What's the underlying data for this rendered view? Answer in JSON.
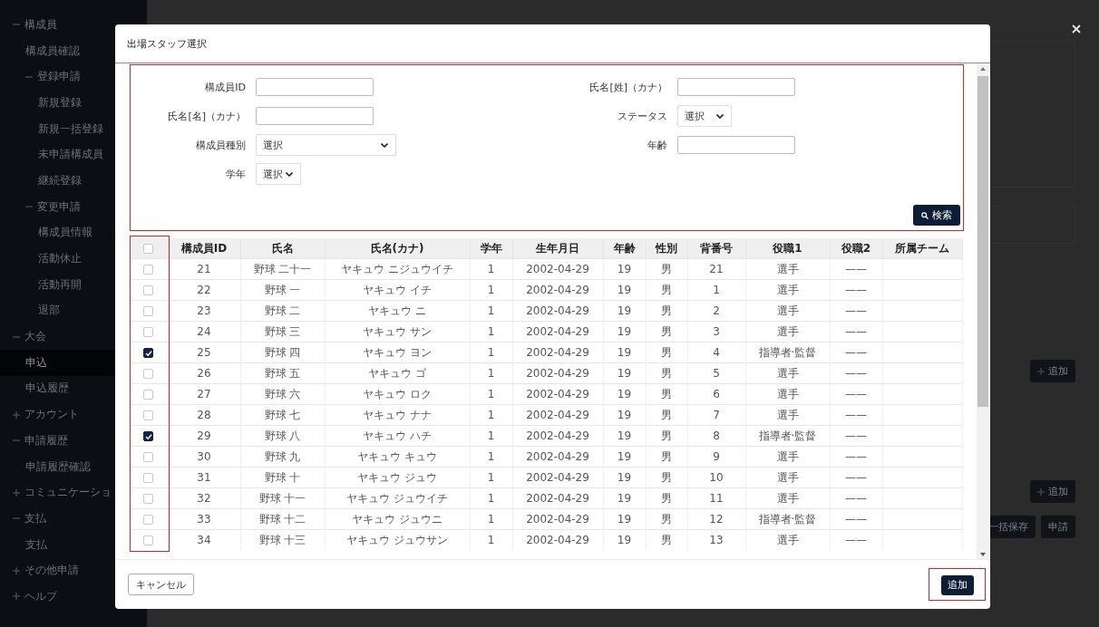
{
  "sidebar": {
    "items": [
      {
        "label": "構成員",
        "expanded": true,
        "selected": false,
        "children": [
          {
            "label": "構成員確認",
            "selected": false
          },
          {
            "label": "登録申請",
            "expanded": true,
            "selected": false,
            "children": [
              {
                "label": "新規登録",
                "selected": false
              },
              {
                "label": "新規一括登録",
                "selected": false
              },
              {
                "label": "未申請構成員",
                "selected": false
              },
              {
                "label": "継続登録",
                "selected": false
              }
            ]
          },
          {
            "label": "変更申請",
            "expanded": true,
            "selected": false,
            "children": [
              {
                "label": "構成員情報",
                "selected": false
              },
              {
                "label": "活動休止",
                "selected": false
              },
              {
                "label": "活動再開",
                "selected": false
              },
              {
                "label": "退部",
                "selected": false
              }
            ]
          }
        ]
      },
      {
        "label": "大会",
        "expanded": true,
        "selected": false,
        "children": [
          {
            "label": "申込",
            "selected": true
          },
          {
            "label": "申込履歴",
            "selected": false
          }
        ]
      },
      {
        "label": "アカウント",
        "expanded": false,
        "selected": false
      },
      {
        "label": "申請履歴",
        "expanded": true,
        "selected": false,
        "children": [
          {
            "label": "申請履歴確認",
            "selected": false
          }
        ]
      },
      {
        "label": "コミュニケーショ",
        "expanded": false,
        "selected": false
      },
      {
        "label": "支払",
        "expanded": true,
        "selected": false,
        "children": [
          {
            "label": "支払",
            "selected": false
          }
        ]
      },
      {
        "label": "その他申請",
        "expanded": false,
        "selected": false
      },
      {
        "label": "ヘルプ",
        "expanded": false,
        "selected": false
      }
    ]
  },
  "background": {
    "add_buttons": [
      "追加",
      "追加"
    ],
    "save_all_button": "一括保存",
    "submit_button": "申請"
  },
  "modal": {
    "title": "出場スタッフ選択",
    "search_form": {
      "fields": [
        {
          "label": "構成員ID",
          "kind": "text"
        },
        {
          "label": "氏名[姓]（カナ）",
          "kind": "text"
        },
        {
          "label": "氏名[名]（カナ）",
          "kind": "text"
        },
        {
          "label": "ステータス",
          "kind": "select",
          "value": "選択"
        },
        {
          "label": "構成員種別",
          "kind": "select",
          "value": "選択"
        },
        {
          "label": "年齢",
          "kind": "text"
        },
        {
          "label": "学年",
          "kind": "select",
          "value": "選択"
        }
      ],
      "search_button": "検索"
    },
    "table": {
      "all_checked": false,
      "columns": [
        "構成員ID",
        "氏名",
        "氏名(カナ)",
        "学年",
        "生年月日",
        "年齢",
        "性別",
        "背番号",
        "役職1",
        "役職2",
        "所属チーム"
      ],
      "rows": [
        {
          "checked": false,
          "cells": [
            "21",
            "野球 二十一",
            "ヤキュウ ニジュウイチ",
            "1",
            "2002-04-29",
            "19",
            "男",
            "21",
            "選手",
            "——"
          ]
        },
        {
          "checked": false,
          "cells": [
            "22",
            "野球 一",
            "ヤキュウ イチ",
            "1",
            "2002-04-29",
            "19",
            "男",
            "1",
            "選手",
            "——"
          ]
        },
        {
          "checked": false,
          "cells": [
            "23",
            "野球 二",
            "ヤキュウ ニ",
            "1",
            "2002-04-29",
            "19",
            "男",
            "2",
            "選手",
            "——"
          ]
        },
        {
          "checked": false,
          "cells": [
            "24",
            "野球 三",
            "ヤキュウ サン",
            "1",
            "2002-04-29",
            "19",
            "男",
            "3",
            "選手",
            "——"
          ]
        },
        {
          "checked": true,
          "cells": [
            "25",
            "野球 四",
            "ヤキュウ ヨン",
            "1",
            "2002-04-29",
            "19",
            "男",
            "4",
            "指導者·監督",
            "——"
          ]
        },
        {
          "checked": false,
          "cells": [
            "26",
            "野球 五",
            "ヤキュウ ゴ",
            "1",
            "2002-04-29",
            "19",
            "男",
            "5",
            "選手",
            "——"
          ]
        },
        {
          "checked": false,
          "cells": [
            "27",
            "野球 六",
            "ヤキュウ ロク",
            "1",
            "2002-04-29",
            "19",
            "男",
            "6",
            "選手",
            "——"
          ]
        },
        {
          "checked": false,
          "cells": [
            "28",
            "野球 七",
            "ヤキュウ ナナ",
            "1",
            "2002-04-29",
            "19",
            "男",
            "7",
            "選手",
            "——"
          ]
        },
        {
          "checked": true,
          "cells": [
            "29",
            "野球 八",
            "ヤキュウ ハチ",
            "1",
            "2002-04-29",
            "19",
            "男",
            "8",
            "指導者·監督",
            "——"
          ]
        },
        {
          "checked": false,
          "cells": [
            "30",
            "野球 九",
            "ヤキュウ キュウ",
            "1",
            "2002-04-29",
            "19",
            "男",
            "9",
            "選手",
            "——"
          ]
        },
        {
          "checked": false,
          "cells": [
            "31",
            "野球 十",
            "ヤキュウ ジュウ",
            "1",
            "2002-04-29",
            "19",
            "男",
            "10",
            "選手",
            "——"
          ]
        },
        {
          "checked": false,
          "cells": [
            "32",
            "野球 十一",
            "ヤキュウ ジュウイチ",
            "1",
            "2002-04-29",
            "19",
            "男",
            "11",
            "選手",
            "——"
          ]
        },
        {
          "checked": false,
          "cells": [
            "33",
            "野球 十二",
            "ヤキュウ ジュウニ",
            "1",
            "2002-04-29",
            "19",
            "男",
            "12",
            "指導者·監督",
            "——"
          ]
        },
        {
          "checked": false,
          "cells": [
            "34",
            "野球 十三",
            "ヤキュウ ジュウサン",
            "1",
            "2002-04-29",
            "19",
            "男",
            "13",
            "選手",
            "——"
          ]
        }
      ]
    },
    "cancel_button": "キャンセル",
    "add_button": "追加"
  }
}
